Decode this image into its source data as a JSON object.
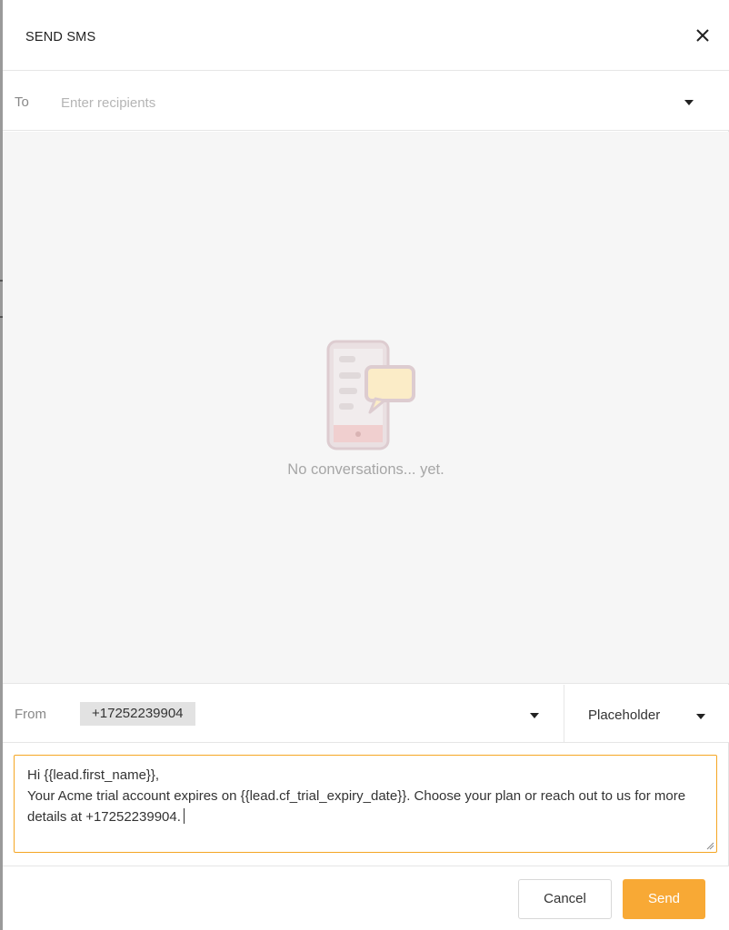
{
  "dialog": {
    "title": "SEND SMS"
  },
  "to": {
    "label": "To",
    "placeholder": "Enter recipients"
  },
  "conversations": {
    "empty_text": "No conversations... yet."
  },
  "from": {
    "label": "From",
    "number": "+17252239904",
    "placeholder_label": "Placeholder"
  },
  "message": {
    "text": "Hi {{lead.first_name}},\nYour Acme trial account expires on {{lead.cf_trial_expiry_date}}. Choose your plan or reach out to us for more details at +17252239904."
  },
  "footer": {
    "cancel_label": "Cancel",
    "send_label": "Send"
  },
  "icons": {
    "close": "close-icon",
    "dropdown": "chevron-down-icon",
    "empty_state": "phone-chat-illustration"
  },
  "colors": {
    "accent": "#f5a623",
    "send_button": "#f8a935",
    "empty_text": "#a6a6a6"
  }
}
